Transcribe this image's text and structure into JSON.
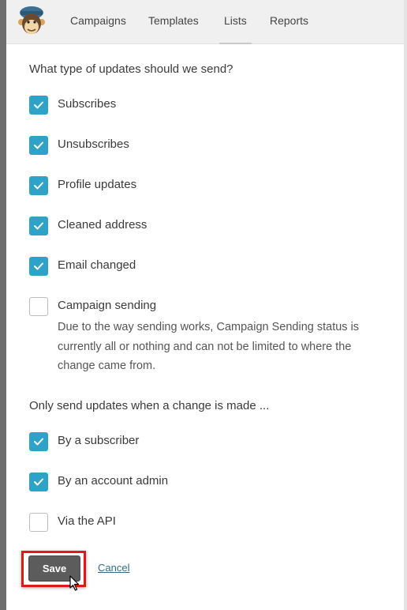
{
  "nav": {
    "logo_icon": "mailchimp-monkey-logo",
    "items": [
      {
        "label": "Campaigns"
      },
      {
        "label": "Templates"
      },
      {
        "label": "Lists",
        "active": true
      },
      {
        "label": "Reports"
      }
    ]
  },
  "update_types": {
    "heading": "What type of updates should we send?",
    "options": [
      {
        "label": "Subscribes",
        "checked": true
      },
      {
        "label": "Unsubscribes",
        "checked": true
      },
      {
        "label": "Profile updates",
        "checked": true
      },
      {
        "label": "Cleaned address",
        "checked": true
      },
      {
        "label": "Email changed",
        "checked": true
      },
      {
        "label": "Campaign sending",
        "checked": false,
        "description": "Due to the way sending works, Campaign Sending status is currently all or nothing and can not be limited to where the change came from."
      }
    ]
  },
  "change_sources": {
    "heading": "Only send updates when a change is made ...",
    "options": [
      {
        "label": "By a subscriber",
        "checked": true
      },
      {
        "label": "By an account admin",
        "checked": true
      },
      {
        "label": "Via the API",
        "checked": false
      }
    ]
  },
  "actions": {
    "save_label": "Save",
    "cancel_label": "Cancel"
  },
  "colors": {
    "checkbox_checked": "#2fa3c7",
    "save_button": "#5c5c5c",
    "highlight_border": "#e01818",
    "link": "#2f6d8a"
  }
}
